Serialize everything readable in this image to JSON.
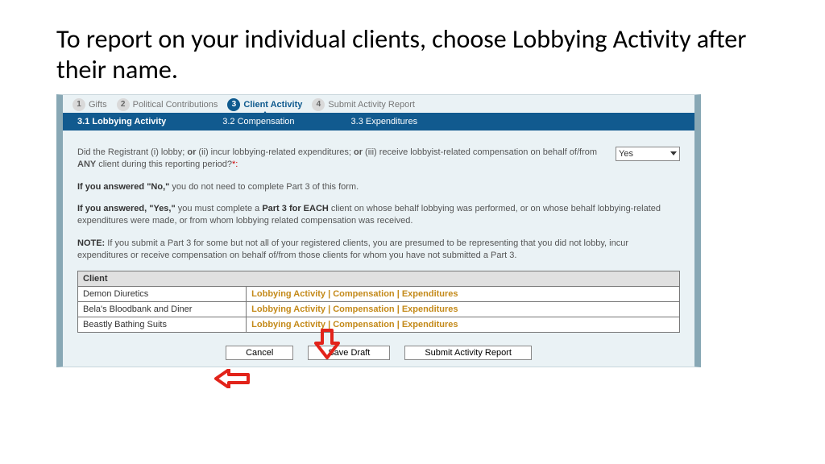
{
  "title": "To report on your individual clients, choose Lobbying  Activity after their name.",
  "steps": [
    {
      "num": "1",
      "label": "Gifts"
    },
    {
      "num": "2",
      "label": "Political Contributions"
    },
    {
      "num": "3",
      "label": "Client Activity"
    },
    {
      "num": "4",
      "label": "Submit Activity Report"
    }
  ],
  "subnav": {
    "a": "3.1 Lobbying Activity",
    "b": "3.2 Compensation",
    "c": "3.3 Expenditures"
  },
  "question": {
    "pre": "Did the Registrant (i) lobby; ",
    "or1": "or",
    "mid1": " (ii) incur lobbying-related expenditures; ",
    "or2": "or",
    "mid2": " (iii) receive lobbyist-related compensation on behalf of/from ",
    "any": "ANY",
    "post": " client during this reporting period?",
    "star_colon": "*:"
  },
  "answer": "Yes",
  "para_no": {
    "b": "If you answered \"No,\"",
    "t": " you do not need to complete Part 3 of this form."
  },
  "para_yes": {
    "b1": "If you answered, \"Yes,\"",
    "t1": " you must complete a ",
    "b2": "Part 3 for EACH",
    "t2": " client on whose behalf lobbying was performed, or on whose behalf lobbying-related expenditures were made, or from whom lobbying related compensation was received."
  },
  "para_note": {
    "b": "NOTE:",
    "t": " If you submit a Part 3 for some but not all of your registered clients, you are presumed to be representing that you did not lobby, incur expenditures or receive compensation on behalf of/from those clients for whom you have not submitted a Part 3."
  },
  "table": {
    "header": "Client",
    "rows": [
      "Demon Diuretics",
      "Bela's Bloodbank and Diner",
      "Beastly Bathing Suits"
    ],
    "actions": {
      "a": "Lobbying Activity",
      "b": "Compensation",
      "c": "Expenditures"
    }
  },
  "buttons": {
    "cancel": "Cancel",
    "draft": "Save Draft",
    "submit": "Submit Activity Report"
  }
}
